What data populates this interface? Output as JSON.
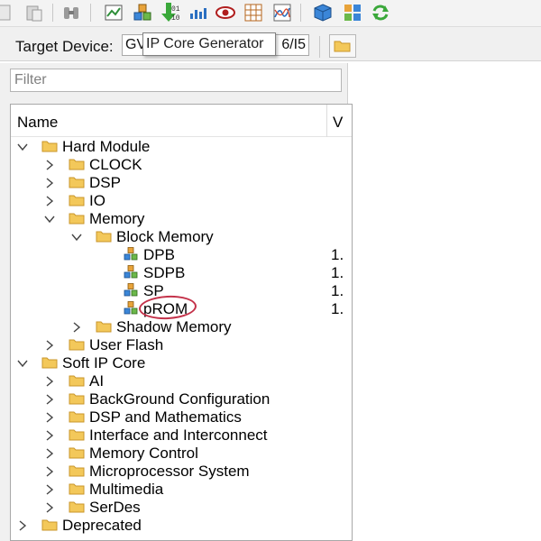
{
  "target": {
    "label": "Target Device:",
    "value_prefix": "GV",
    "value_suffix": "6/I5"
  },
  "tooltip": "IP Core Generator",
  "filter": {
    "placeholder": "Filter",
    "value": ""
  },
  "columns": {
    "name": "Name",
    "version": "V"
  },
  "tree": {
    "hard_module": "Hard Module",
    "clock": "CLOCK",
    "dsp": "DSP",
    "io": "IO",
    "memory": "Memory",
    "block_memory": "Block Memory",
    "dpb": "DPB",
    "sdpb": "SDPB",
    "sp": "SP",
    "prom": "pROM",
    "version_truncated": "1.",
    "shadow_memory": "Shadow Memory",
    "user_flash": "User Flash",
    "soft_ip_core": "Soft IP Core",
    "ai": "AI",
    "background_configuration": "BackGround Configuration",
    "dsp_and_mathematics": "DSP and Mathematics",
    "interface_and_interconnect": "Interface and Interconnect",
    "memory_control": "Memory Control",
    "microprocessor_system": "Microprocessor System",
    "multimedia": "Multimedia",
    "serdes": "SerDes",
    "deprecated": "Deprecated"
  },
  "icons": {
    "folder": "folder-icon",
    "ip_core": "ip-core-cubes-icon",
    "expand": "chevron-right-icon",
    "collapse": "chevron-down-icon"
  },
  "colors": {
    "folder": "#f3c85a",
    "annotation_circle": "#c4324a",
    "cube_blue": "#3b86d8",
    "cube_green": "#6cb84a",
    "cube_orange": "#e8a33a"
  }
}
